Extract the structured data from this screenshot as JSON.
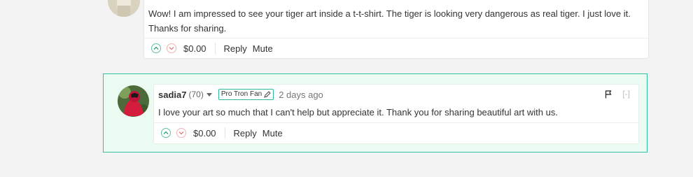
{
  "comment1": {
    "body": "Wow! I am impressed to see your tiger art inside a t-t-shirt. The tiger is looking very dangerous as real tiger. I just love it. Thanks for sharing.",
    "payout": "$0.00",
    "reply_label": "Reply",
    "mute_label": "Mute"
  },
  "comment2": {
    "author": "sadia7",
    "reputation": "(70)",
    "badge": "Pro Tron Fan",
    "age": "2 days ago",
    "collapse_label": "[-]",
    "body": "I love your art so much that I can't help but appreciate it. Thank you for sharing beautiful art with us.",
    "payout": "$0.00",
    "reply_label": "Reply",
    "mute_label": "Mute"
  },
  "colors": {
    "highlight_border": "#2fc2a1",
    "highlight_bg": "#ecfbf2",
    "upvote": "#2a9d78",
    "downvote": "#e07b7b"
  },
  "icons": [
    "chevron-up-icon",
    "chevron-down-icon",
    "flag-icon",
    "pencil-icon",
    "caret-down-icon"
  ]
}
